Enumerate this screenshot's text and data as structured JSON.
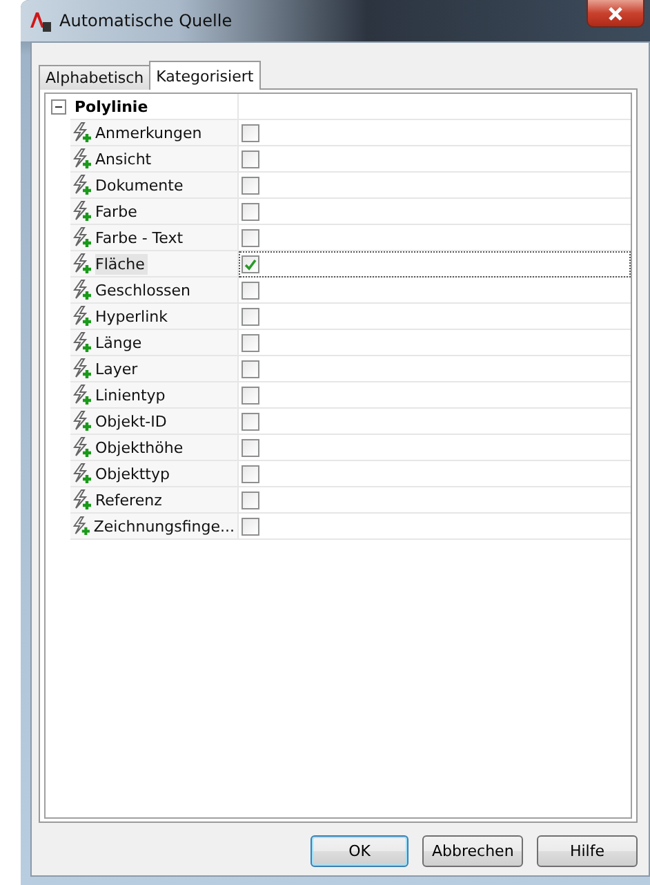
{
  "window": {
    "title": "Automatische Quelle"
  },
  "tabs": [
    {
      "label": "Alphabetisch",
      "selected": false
    },
    {
      "label": "Kategorisiert",
      "selected": true
    }
  ],
  "category": {
    "label": "Polylinie",
    "expanded": true
  },
  "properties": [
    {
      "name": "Anmerkungen",
      "checked": false,
      "selected": false
    },
    {
      "name": "Ansicht",
      "checked": false,
      "selected": false
    },
    {
      "name": "Dokumente",
      "checked": false,
      "selected": false
    },
    {
      "name": "Farbe",
      "checked": false,
      "selected": false
    },
    {
      "name": "Farbe - Text",
      "checked": false,
      "selected": false
    },
    {
      "name": "Fläche",
      "checked": true,
      "selected": true
    },
    {
      "name": "Geschlossen",
      "checked": false,
      "selected": false
    },
    {
      "name": "Hyperlink",
      "checked": false,
      "selected": false
    },
    {
      "name": "Länge",
      "checked": false,
      "selected": false
    },
    {
      "name": "Layer",
      "checked": false,
      "selected": false
    },
    {
      "name": "Linientyp",
      "checked": false,
      "selected": false
    },
    {
      "name": "Objekt-ID",
      "checked": false,
      "selected": false
    },
    {
      "name": "Objekthöhe",
      "checked": false,
      "selected": false
    },
    {
      "name": "Objekttyp",
      "checked": false,
      "selected": false
    },
    {
      "name": "Referenz",
      "checked": false,
      "selected": false
    },
    {
      "name": "Zeichnungsfinge...",
      "checked": false,
      "selected": false
    }
  ],
  "buttons": [
    {
      "label": "OK",
      "default": true
    },
    {
      "label": "Abbrechen",
      "default": false
    },
    {
      "label": "Hilfe",
      "default": false
    }
  ]
}
